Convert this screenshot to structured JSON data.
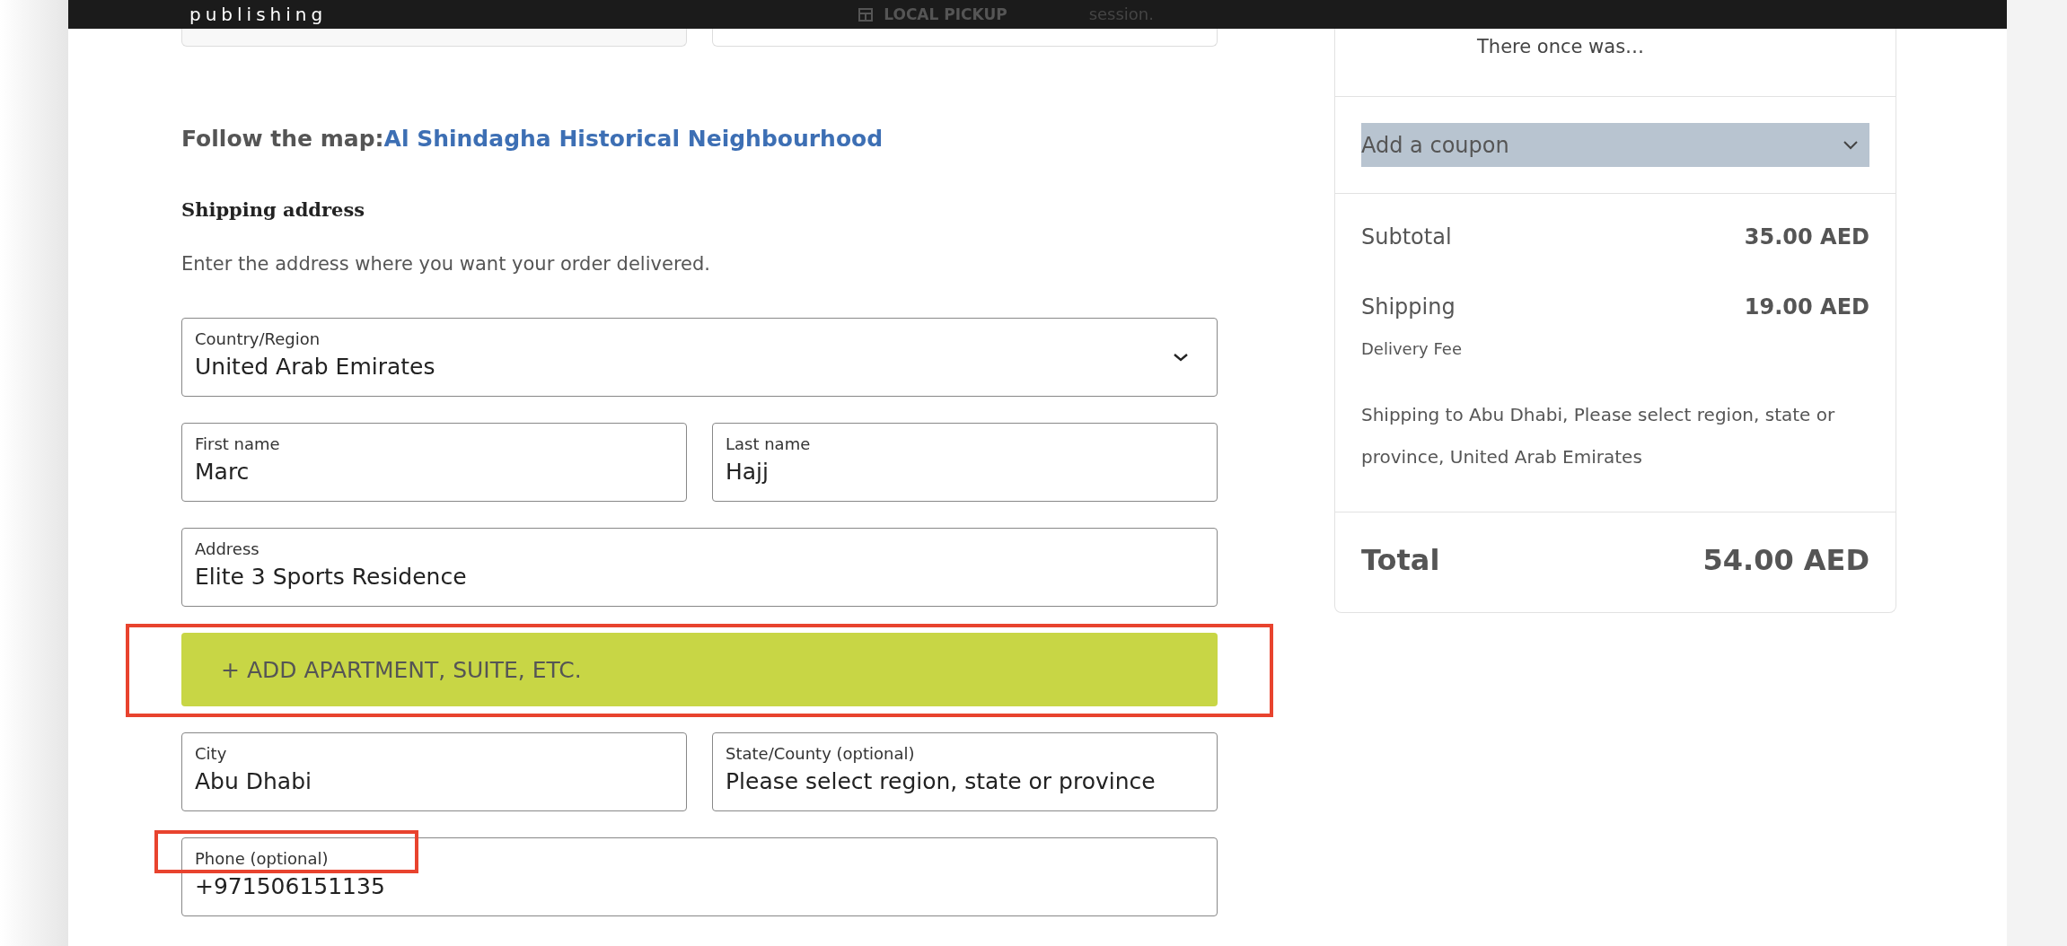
{
  "top_bar": {
    "brand": "publishing",
    "pickup_label": "LOCAL PICKUP",
    "notice": "session."
  },
  "map_link": {
    "prefix": "Follow the map:",
    "link": "Al Shindagha Historical Neighbourhood"
  },
  "shipping_address": {
    "title": "Shipping address",
    "description": "Enter the address where you want your order delivered.",
    "rows": [
      [
        {
          "kind": "select",
          "label": "Country/Region",
          "value": "United Arab Emirates",
          "highlighted": false
        }
      ],
      [
        {
          "kind": "text",
          "label": "First name",
          "value": "Marc",
          "highlighted": false
        },
        {
          "kind": "text",
          "label": "Last name",
          "value": "Hajj",
          "highlighted": false
        }
      ],
      [
        {
          "kind": "text",
          "label": "Address",
          "value": "Elite 3 Sports Residence",
          "highlighted": false
        }
      ],
      [
        {
          "kind": "button",
          "label": "+ ADD APARTMENT, SUITE, ETC.",
          "highlighted": true
        }
      ],
      [
        {
          "kind": "text",
          "label": "City",
          "value": "Abu Dhabi",
          "highlighted": false
        },
        {
          "kind": "text",
          "label": "State/County (optional)",
          "value": "Please select region, state or province",
          "highlighted": false
        }
      ],
      [
        {
          "kind": "text",
          "label": "Phone (optional)",
          "value": "+971506151135",
          "highlighted": true
        }
      ]
    ]
  },
  "order_summary": {
    "item_text": "There once was…",
    "coupon": {
      "label": "Add a coupon",
      "expanded": false
    },
    "subtotal": {
      "label": "Subtotal",
      "value": "35.00 AED"
    },
    "shipping": {
      "label": "Shipping",
      "value": "19.00 AED",
      "method": "Delivery Fee",
      "destination": "Shipping to Abu Dhabi, Please select region, state or province, United Arab Emirates"
    },
    "total": {
      "label": "Total",
      "value": "54.00 AED"
    }
  }
}
